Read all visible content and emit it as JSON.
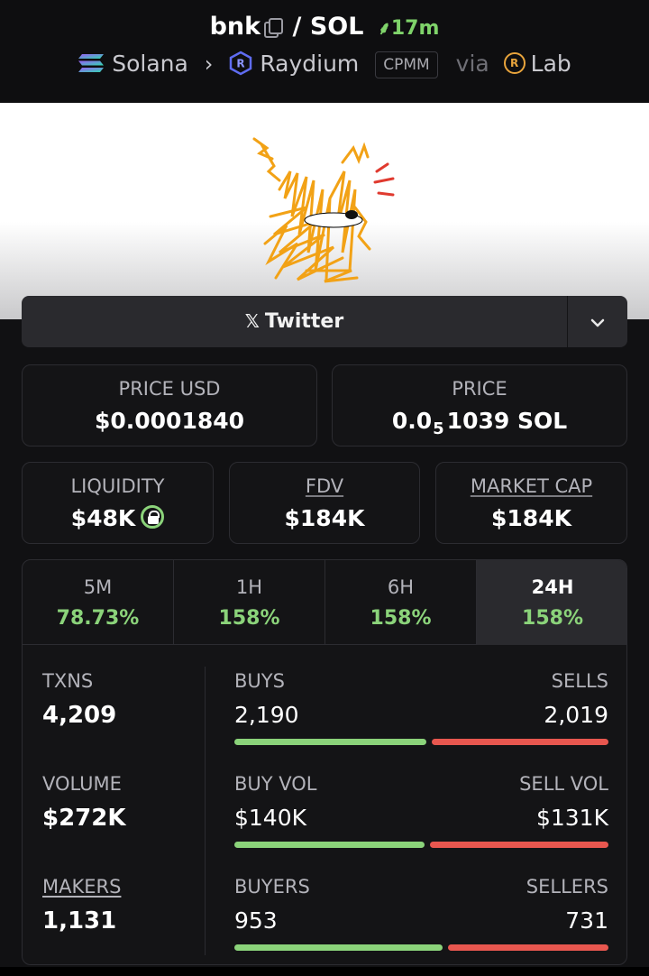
{
  "header": {
    "token": "bnk",
    "pair_sep": "/",
    "quote": "SOL",
    "age": "17m",
    "chain": "Solana",
    "dex": "Raydium",
    "pool_type": "CPMM",
    "via": "via",
    "launchpad": "Lab"
  },
  "social": {
    "twitter_label": "Twitter"
  },
  "prices": {
    "price_usd_label": "PRICE USD",
    "price_usd": "$0.0001840",
    "price_label": "PRICE",
    "price_prefix": "0.0",
    "price_sub": "5",
    "price_rest": "1039 SOL"
  },
  "metrics": {
    "liquidity_label": "LIQUIDITY",
    "liquidity": "$48K",
    "fdv_label": "FDV",
    "fdv": "$184K",
    "mcap_label": "MARKET CAP",
    "mcap": "$184K"
  },
  "tabs": [
    {
      "label": "5M",
      "value": "78.73%"
    },
    {
      "label": "1H",
      "value": "158%"
    },
    {
      "label": "6H",
      "value": "158%"
    },
    {
      "label": "24H",
      "value": "158%"
    }
  ],
  "active_tab": "24H",
  "stats": {
    "txns_label": "TXNS",
    "txns": "4,209",
    "volume_label": "VOLUME",
    "volume": "$272K",
    "makers_label": "MAKERS",
    "makers": "1,131",
    "buys_label": "BUYS",
    "buys": "2,190",
    "sells_label": "SELLS",
    "sells": "2,019",
    "buy_vol_label": "BUY VOL",
    "buy_vol": "$140K",
    "sell_vol_label": "SELL VOL",
    "sell_vol": "$131K",
    "buyers_label": "BUYERS",
    "buyers": "953",
    "sellers_label": "SELLERS",
    "sellers": "731",
    "buy_share_txns": 0.52,
    "buy_share_vol": 0.517,
    "buy_share_makers": 0.566
  },
  "colors": {
    "positive": "#8bd37a",
    "negative": "#e8574f",
    "accent_orange": "#f2a216"
  }
}
